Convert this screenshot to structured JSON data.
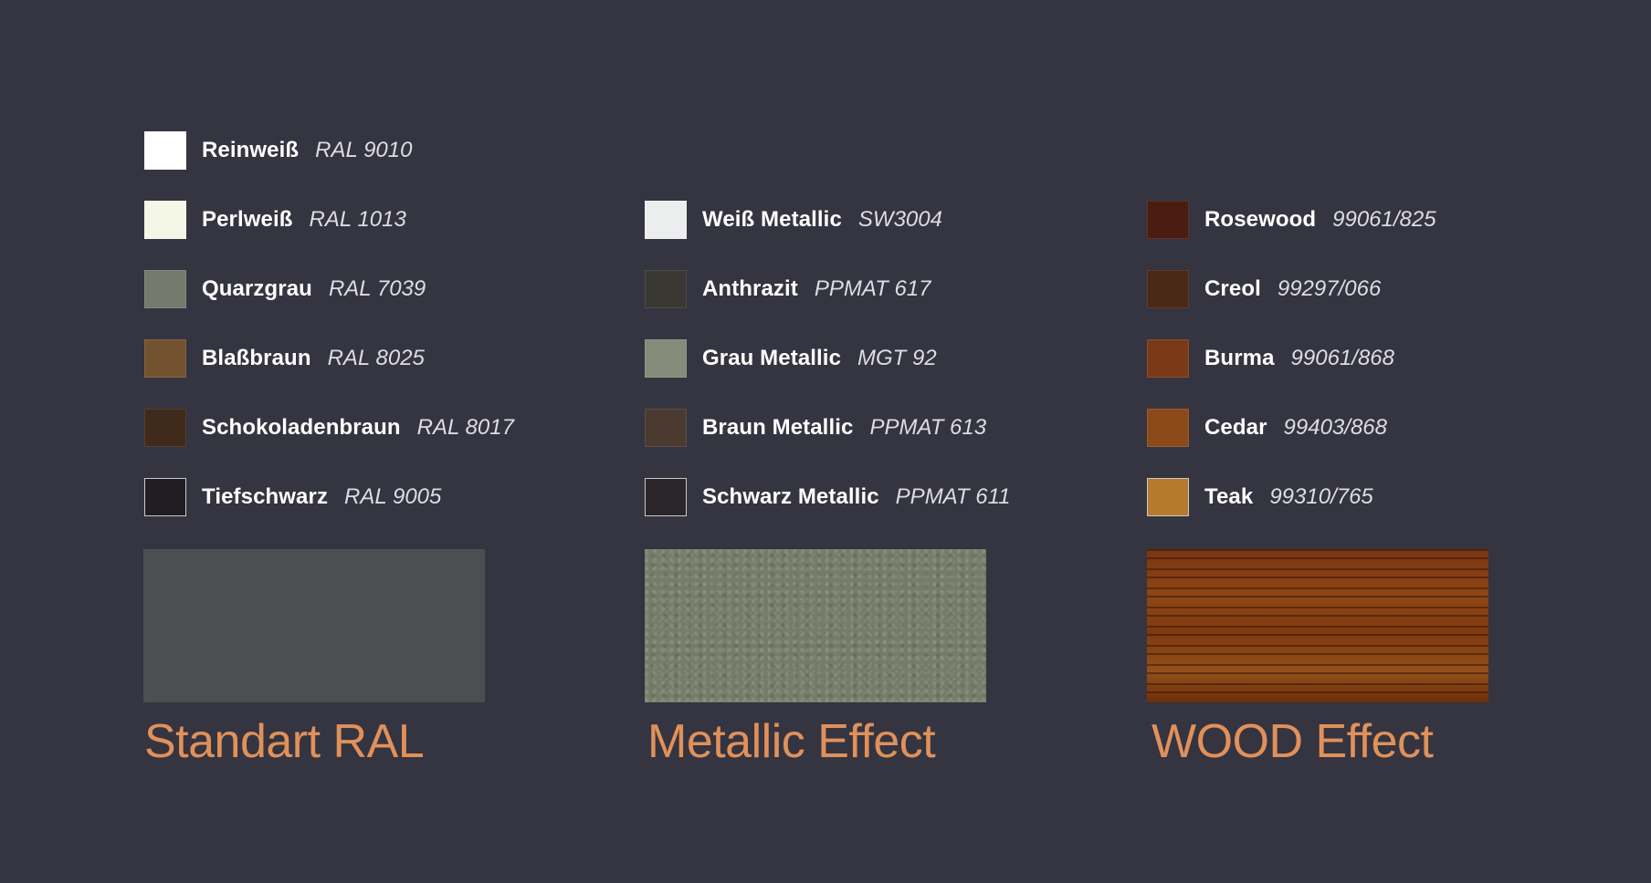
{
  "groups": [
    {
      "title": "Standart RAL",
      "sample_texture": "solid",
      "items": [
        {
          "name": "Reinweiß",
          "code": "RAL 9010",
          "color": "#ffffff"
        },
        {
          "name": "Perlweiß",
          "code": "RAL 1013",
          "color": "#f4f7e6"
        },
        {
          "name": "Quarzgrau",
          "code": "RAL 7039",
          "color": "#747b6e"
        },
        {
          "name": "Blaßbraun",
          "code": "RAL 8025",
          "color": "#73532f"
        },
        {
          "name": "Schokoladenbraun",
          "code": "RAL 8017",
          "color": "#3f2a1b"
        },
        {
          "name": "Tiefschwarz",
          "code": "RAL 9005",
          "color": "#211d22"
        }
      ],
      "sample_color": "#4b4f4f"
    },
    {
      "title": "Metallic Effect",
      "sample_texture": "metallic",
      "items": [
        {
          "name": "Weiß Metallic",
          "code": "SW3004",
          "color": "#eceded"
        },
        {
          "name": "Anthrazit",
          "code": "PPMAT 617",
          "color": "#3a3833"
        },
        {
          "name": "Grau Metallic",
          "code": "MGT 92",
          "color": "#858a79"
        },
        {
          "name": "Braun Metallic",
          "code": "PPMAT 613",
          "color": "#4a3a30"
        },
        {
          "name": "Schwarz Metallic",
          "code": "PPMAT 611",
          "color": "#2a2529"
        }
      ],
      "sample_color": "#767c6a"
    },
    {
      "title": "WOOD Effect",
      "sample_texture": "wood",
      "items": [
        {
          "name": "Rosewood",
          "code": "99061/825",
          "color": "#4b1d12"
        },
        {
          "name": "Creol",
          "code": "99297/066",
          "color": "#4a2818"
        },
        {
          "name": "Burma",
          "code": "99061/868",
          "color": "#7a3a18"
        },
        {
          "name": "Cedar",
          "code": "99403/868",
          "color": "#8c4a1a"
        },
        {
          "name": "Teak",
          "code": "99310/765",
          "color": "#b67a2e"
        }
      ],
      "sample_color": "#7d3a10"
    }
  ]
}
